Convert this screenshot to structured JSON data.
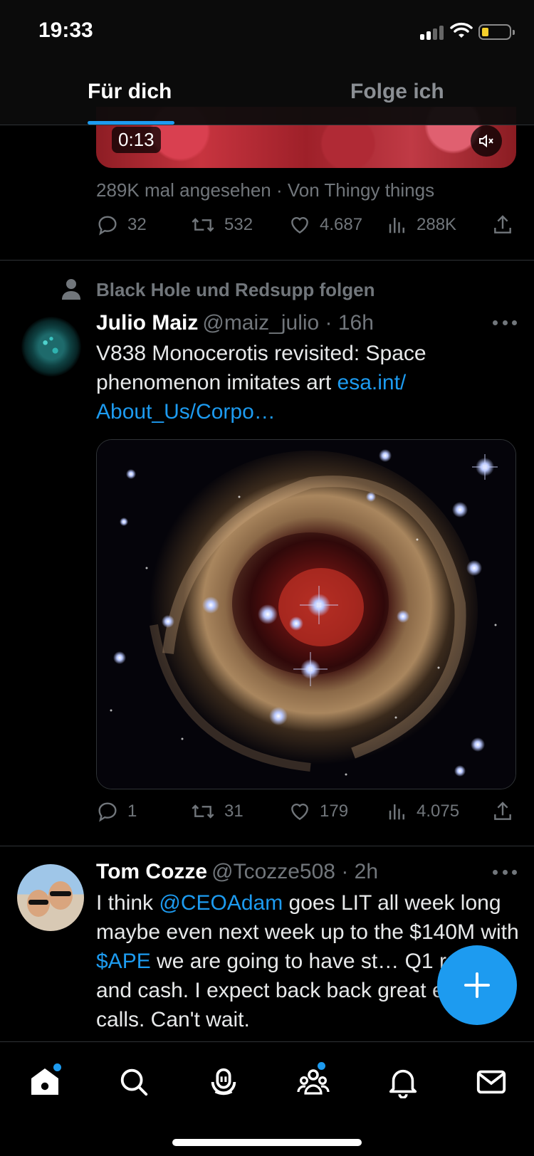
{
  "status_bar": {
    "time": "19:33"
  },
  "header": {
    "tabs": [
      {
        "label": "Für dich",
        "active": true
      },
      {
        "label": "Folge ich",
        "active": false
      }
    ]
  },
  "video_tweet": {
    "duration": "0:13",
    "views_line": "289K mal angesehen · Von Thingy things",
    "stats": {
      "replies": "32",
      "retweets": "532",
      "likes": "4.687",
      "views": "288K"
    }
  },
  "tweet1": {
    "social_context": "Black Hole und Redsupp folgen",
    "name": "Julio Maiz",
    "handle_time": "@maiz_julio · 16h",
    "text": "V838 Monocerotis revisited: Space phenomenon imitates art ",
    "link": "esa.int/\nAbout_Us/Corpo…",
    "stats": {
      "replies": "1",
      "retweets": "31",
      "likes": "179",
      "views": "4.075"
    }
  },
  "tweet2": {
    "name": "Tom Cozze",
    "handle_time": "@Tcozze508 · 2h",
    "text_part1": "I think ",
    "mention": "@CEOAdam",
    "text_part2": " goes LIT all week long maybe even next week up to the $140M with ",
    "cashtag": "$APE",
    "text_part3": " we are going to have st… Q1 results and cash. I expect back back great earning calls. Can't wait."
  },
  "nav": {
    "items": [
      "home",
      "search",
      "spaces",
      "communities",
      "notifications",
      "messages"
    ]
  },
  "colors": {
    "accent": "#1d9bf0",
    "background": "#000000",
    "secondary_text": "#71767b"
  }
}
